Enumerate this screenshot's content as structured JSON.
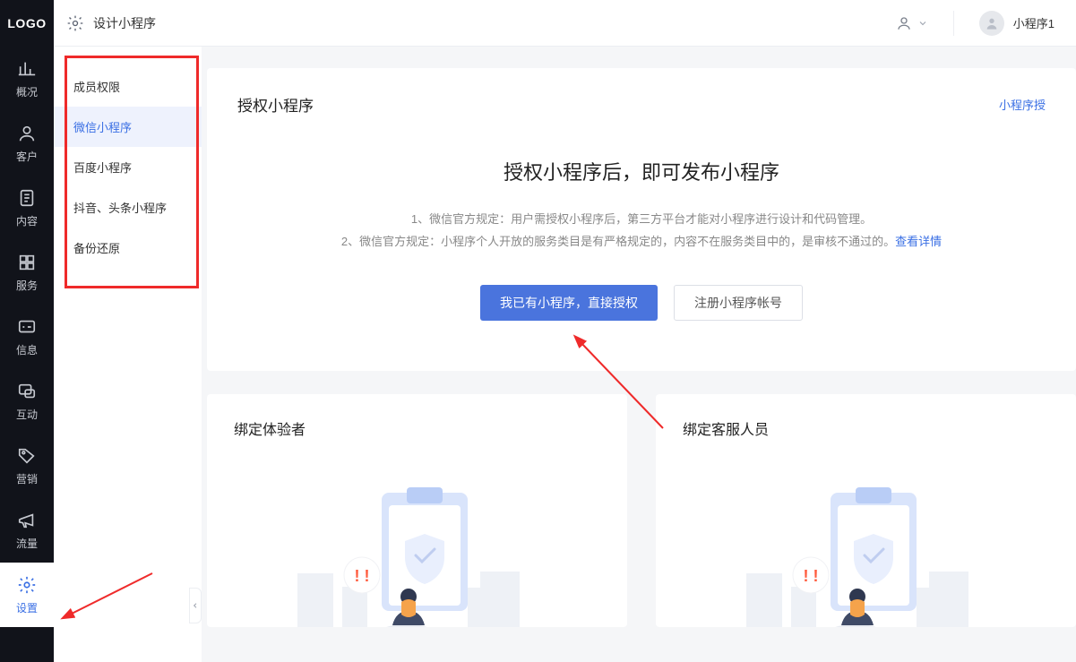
{
  "brand": "LOGO",
  "header": {
    "design_label": "设计小程序",
    "user_name": "小程序1"
  },
  "rail": {
    "items": [
      {
        "id": "overview",
        "label": "概况"
      },
      {
        "id": "customer",
        "label": "客户"
      },
      {
        "id": "content",
        "label": "内容"
      },
      {
        "id": "service",
        "label": "服务"
      },
      {
        "id": "message",
        "label": "信息"
      },
      {
        "id": "interact",
        "label": "互动"
      },
      {
        "id": "marketing",
        "label": "营销"
      },
      {
        "id": "traffic",
        "label": "流量"
      },
      {
        "id": "settings",
        "label": "设置"
      }
    ]
  },
  "subside": {
    "items": [
      {
        "id": "perm",
        "label": "成员权限"
      },
      {
        "id": "wechat",
        "label": "微信小程序",
        "active": true
      },
      {
        "id": "baidu",
        "label": "百度小程序"
      },
      {
        "id": "douyin",
        "label": "抖音、头条小程序"
      },
      {
        "id": "backup",
        "label": "备份还原"
      }
    ]
  },
  "main": {
    "page_title": "授权小程序",
    "right_link": "小程序授",
    "hero": "授权小程序后，即可发布小程序",
    "rule1": "1、微信官方规定：用户需授权小程序后，第三方平台才能对小程序进行设计和代码管理。",
    "rule2_prefix": "2、微信官方规定：小程序个人开放的服务类目是有严格规定的，内容不在服务类目中的，是审核不通过的。",
    "rule2_link": "查看详情",
    "btn_primary": "我已有小程序，直接授权",
    "btn_ghost": "注册小程序帐号",
    "subcard1_title": "绑定体验者",
    "subcard2_title": "绑定客服人员"
  }
}
